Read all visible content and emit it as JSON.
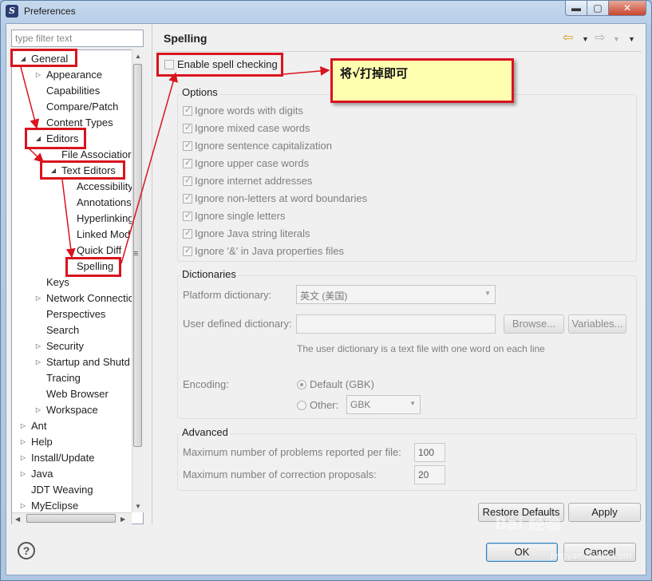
{
  "window": {
    "title": "Preferences",
    "minimize_glyph": "▬",
    "maximize_glyph": "▢",
    "close_glyph": "✕",
    "app_icon_glyph": "S"
  },
  "sidebar": {
    "filter_placeholder": "type filter text",
    "items": [
      {
        "label": "General",
        "expander": "◢"
      },
      {
        "label": "Appearance",
        "expander": "▷"
      },
      {
        "label": "Capabilities",
        "expander": ""
      },
      {
        "label": "Compare/Patch",
        "expander": ""
      },
      {
        "label": "Content Types",
        "expander": ""
      },
      {
        "label": "Editors",
        "expander": "◢"
      },
      {
        "label": "File Associatior",
        "expander": ""
      },
      {
        "label": "Text Editors",
        "expander": "◢"
      },
      {
        "label": "Accessibility",
        "expander": ""
      },
      {
        "label": "Annotations",
        "expander": ""
      },
      {
        "label": "Hyperlinking",
        "expander": ""
      },
      {
        "label": "Linked Mod",
        "expander": ""
      },
      {
        "label": "Quick Diff",
        "expander": ""
      },
      {
        "label": "Spelling",
        "expander": ""
      },
      {
        "label": "Keys",
        "expander": ""
      },
      {
        "label": "Network Connectio",
        "expander": "▷"
      },
      {
        "label": "Perspectives",
        "expander": ""
      },
      {
        "label": "Search",
        "expander": ""
      },
      {
        "label": "Security",
        "expander": "▷"
      },
      {
        "label": "Startup and Shutd",
        "expander": "▷"
      },
      {
        "label": "Tracing",
        "expander": ""
      },
      {
        "label": "Web Browser",
        "expander": ""
      },
      {
        "label": "Workspace",
        "expander": "▷"
      },
      {
        "label": "Ant",
        "expander": "▷"
      },
      {
        "label": "Help",
        "expander": "▷"
      },
      {
        "label": "Install/Update",
        "expander": "▷"
      },
      {
        "label": "Java",
        "expander": "▷"
      },
      {
        "label": "JDT Weaving",
        "expander": ""
      },
      {
        "label": "MyEclipse",
        "expander": "▷"
      }
    ],
    "scroll_up": "▲",
    "scroll_down": "▼",
    "scroll_left": "◀",
    "scroll_right": "▶",
    "grip": "≡"
  },
  "main": {
    "title": "Spelling",
    "nav_back": "⇦",
    "nav_forward": "⇨",
    "dropdown_glyph": "▼",
    "enable_spell": {
      "label": "Enable spell checking",
      "checked": false
    },
    "options": {
      "legend": "Options",
      "items": [
        {
          "label": "Ignore words with digits",
          "checked": true
        },
        {
          "label": "Ignore mixed case words",
          "checked": true
        },
        {
          "label": "Ignore sentence capitalization",
          "checked": true
        },
        {
          "label": "Ignore upper case words",
          "checked": true
        },
        {
          "label": "Ignore internet addresses",
          "checked": true
        },
        {
          "label": "Ignore non-letters at word boundaries",
          "checked": true
        },
        {
          "label": "Ignore single letters",
          "checked": true
        },
        {
          "label": "Ignore Java string literals",
          "checked": true
        },
        {
          "label": "Ignore '&' in Java properties files",
          "checked": true
        }
      ]
    },
    "dictionaries": {
      "legend": "Dictionaries",
      "platform_label": "Platform dictionary:",
      "platform_value": "英文 (美国)",
      "user_label": "User defined dictionary:",
      "user_value": "",
      "browse_label": "Browse...",
      "variables_label": "Variables...",
      "hint": "The user dictionary is a text file with one word on each line",
      "encoding_label": "Encoding:",
      "default_label": "Default (GBK)",
      "other_label": "Other:",
      "other_value": "GBK"
    },
    "advanced": {
      "legend": "Advanced",
      "max_problems_label": "Maximum number of problems reported per file:",
      "max_problems_value": "100",
      "max_proposals_label": "Maximum number of correction proposals:",
      "max_proposals_value": "20"
    },
    "restore_defaults_label": "Restore Defaults",
    "apply_label": "Apply"
  },
  "footer": {
    "help_glyph": "?",
    "ok_label": "OK",
    "cancel_label": "Cancel"
  },
  "annotation": {
    "note_text": "将√打掉即可",
    "highlight_color": "#d9141e"
  },
  "watermark": {
    "text": "Bai 经验",
    "url": "jingyan.baidu.com"
  }
}
